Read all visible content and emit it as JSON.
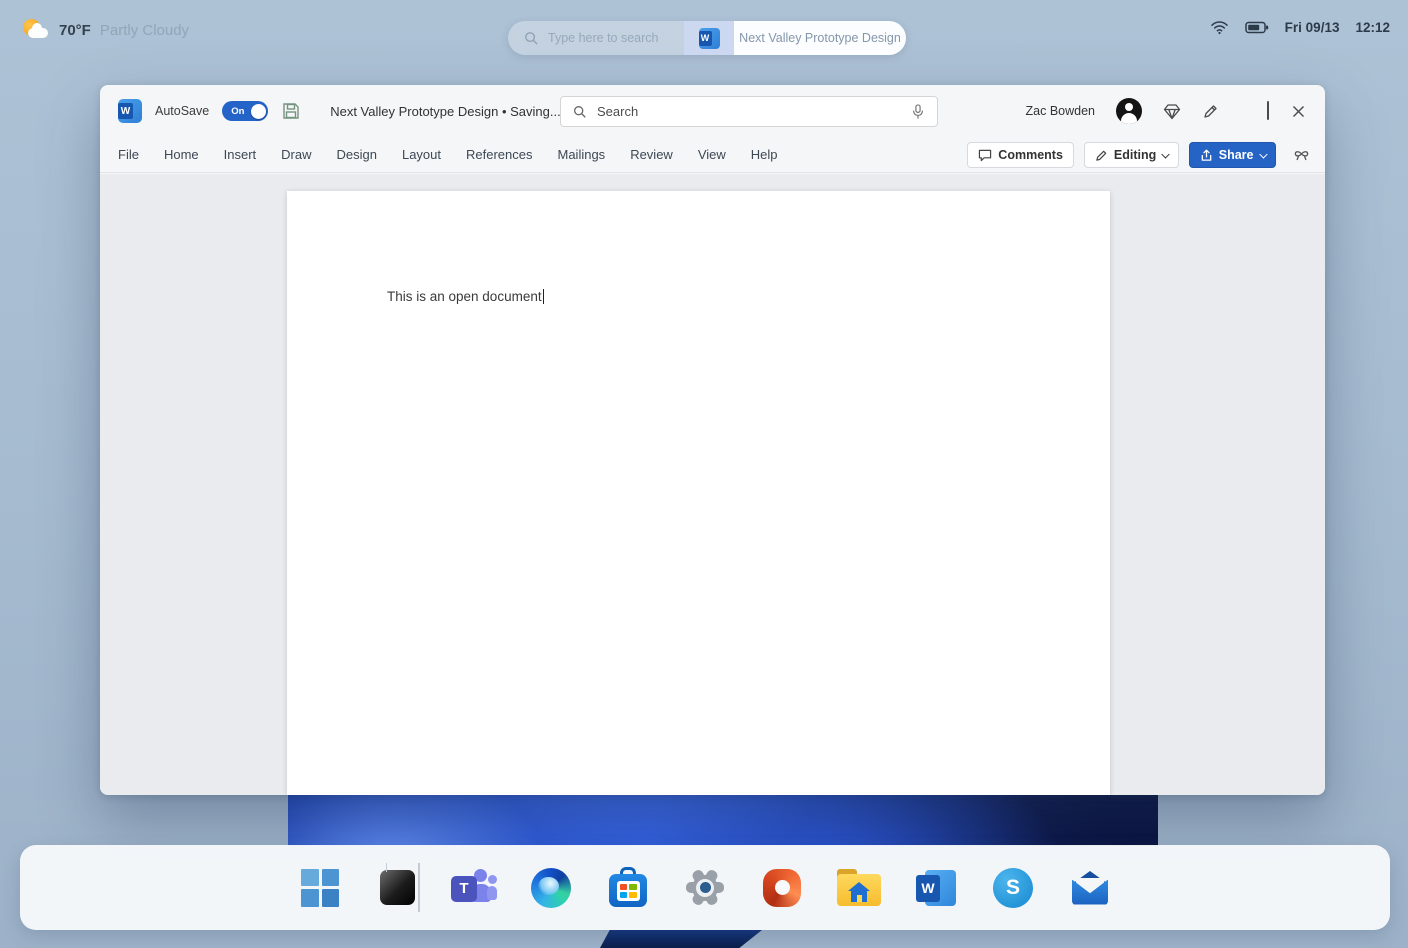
{
  "colors": {
    "desktop_bg": "#a6bbd0",
    "dock_bg": "#f8fafc",
    "window_bg": "#f5f6f8",
    "doc_area_bg": "#e9ebee",
    "accent_blue": "#2563c5",
    "word_blue": "#185abd",
    "toggle_on_blue": "#2464c8"
  },
  "topbar": {
    "weather": {
      "icon": "sun-cloud-icon",
      "temperature": "70°F",
      "condition": "Partly Cloudy"
    },
    "search": {
      "icon": "search-icon",
      "placeholder": "Type here to search"
    },
    "running_app": {
      "icon": "word-icon",
      "label": "Next Valley Prototype Design"
    },
    "tray": {
      "date": "Fri 09/13",
      "time": "12:12"
    }
  },
  "word": {
    "titlebar": {
      "app_icon_letter": "W",
      "autosave_label": "AutoSave",
      "autosave_state": "On",
      "title": "Next Valley Prototype Design • Saving...",
      "search_placeholder": "Search",
      "user": "Zac Bowden"
    },
    "ribbon": {
      "tabs": [
        "File",
        "Home",
        "Insert",
        "Draw",
        "Design",
        "Layout",
        "References",
        "Mailings",
        "Review",
        "View",
        "Help"
      ],
      "comments": "Comments",
      "editing": "Editing",
      "share": "Share"
    },
    "document": {
      "text": "This is an open document"
    }
  },
  "dock": {
    "apps": [
      {
        "name": "start",
        "icon": "windows-logo-icon"
      },
      {
        "name": "dark-app",
        "icon": "dark-square-app-icon"
      },
      {
        "name": "teams",
        "icon": "teams-icon",
        "letter": "T"
      },
      {
        "name": "edge",
        "icon": "edge-icon"
      },
      {
        "name": "store",
        "icon": "microsoft-store-icon"
      },
      {
        "name": "settings",
        "icon": "settings-gear-icon"
      },
      {
        "name": "office",
        "icon": "office-icon"
      },
      {
        "name": "file-explorer",
        "icon": "file-explorer-icon"
      },
      {
        "name": "word",
        "icon": "word-icon",
        "letter": "W"
      },
      {
        "name": "skype",
        "icon": "skype-icon",
        "letter": "S"
      },
      {
        "name": "mail",
        "icon": "mail-icon"
      }
    ]
  }
}
